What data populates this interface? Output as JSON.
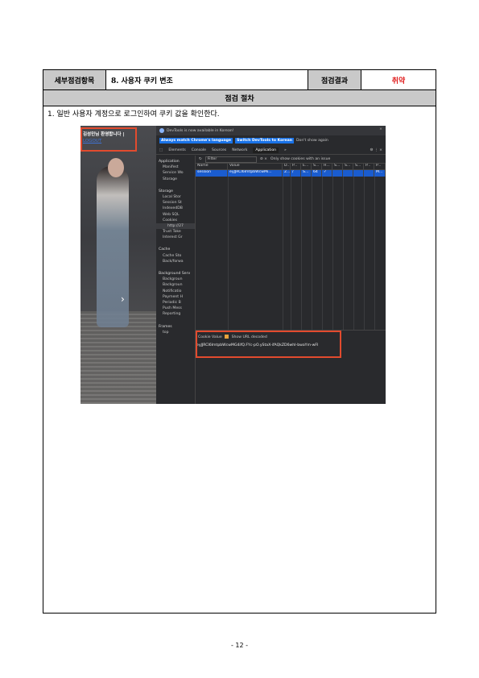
{
  "header": {
    "item_label": "세부점검항목",
    "item_value": "8. 사용자 쿠키 변조",
    "result_label": "점검결과",
    "result_value": "취약"
  },
  "section_title": "점검 절차",
  "step_text": "1. 일반 사용자 계정으로 로그인하여 쿠키 값을 확인한다.",
  "screenshot": {
    "welcome": "김성민님 환영합니다 |",
    "logout": "LOGOUT",
    "banner": "DevTools is now available in Korean!",
    "btn_match": "Always match Chrome's language",
    "btn_switch": "Switch DevTools to Korean",
    "dont_show": "Don't show again",
    "tabs": [
      "Elements",
      "Console",
      "Sources",
      "Network",
      "Application"
    ],
    "active_tab": "Application",
    "sidebar": {
      "app_head": "Application",
      "app_items": [
        "Manifest",
        "Service Wo",
        "Storage"
      ],
      "storage_head": "Storage",
      "storage_items": [
        "Local Stor",
        "Session St",
        "IndexedDB",
        "Web SQL",
        "Cookies",
        "http://27",
        "Trust Toke",
        "Interest Gr"
      ],
      "cache_head": "Cache",
      "cache_items": [
        "Cache Sto",
        "Back/forwa"
      ],
      "bg_head": "Background Serv",
      "bg_items": [
        "Backgroun",
        "Backgroun",
        "Notificatio",
        "Payment H",
        "Periodic B",
        "Push Mess",
        "Reporting"
      ],
      "frames_head": "Frames",
      "frames_items": [
        "top"
      ]
    },
    "filter_placeholder": "Filter",
    "only_issue": "Only show cookies with an issue",
    "columns": [
      "Name",
      "Value",
      "D...",
      "P...",
      "E...",
      "S...",
      "H...",
      "S...",
      "S...",
      "S...",
      "P...",
      "P..."
    ],
    "row": [
      "session",
      "eyJJRCI6ImtpbWcwMi...",
      "2...",
      "/",
      "S...",
      "64",
      "✓",
      "",
      "",
      "",
      "",
      "M..."
    ],
    "cookie_value_label": "Cookie Value",
    "show_url_decoded": "Show URL decoded",
    "cookie_value": "eyJJRCI6ImtpbWcwMG4ifQ.FYc-pO.yStaX-ifAQkZD6whI-bwaYm-wFI"
  },
  "page_number": "- 12 -"
}
